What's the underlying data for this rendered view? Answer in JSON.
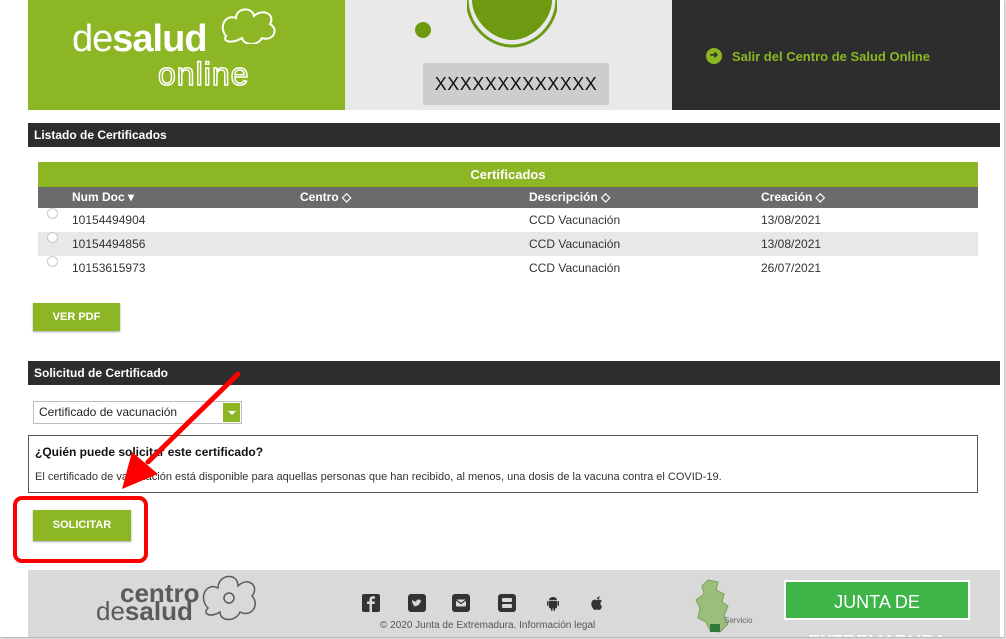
{
  "header": {
    "logo_line1_light": "de",
    "logo_line1_bold": "salud",
    "logo_line2": "online",
    "user_name": "XXXXXXXXXXXXX",
    "exit_label": "Salir del Centro de Salud Online"
  },
  "listado": {
    "section_title": "Listado de Certificados",
    "table_caption": "Certificados",
    "columns": [
      "Num Doc ▾",
      "Centro ◇",
      "Descripción ◇",
      "Creación ◇"
    ],
    "rows": [
      {
        "num_doc": "10154494904",
        "centro": "",
        "descripcion": "CCD Vacunación",
        "creacion": "13/08/2021"
      },
      {
        "num_doc": "10154494856",
        "centro": "",
        "descripcion": "CCD Vacunación",
        "creacion": "13/08/2021"
      },
      {
        "num_doc": "10153615973",
        "centro": "",
        "descripcion": "CCD Vacunación",
        "creacion": "26/07/2021"
      }
    ],
    "ver_pdf_label": "VER PDF"
  },
  "solicitud": {
    "section_title": "Solicitud de Certificado",
    "select_value": "Certificado de vacunación",
    "info_question": "¿Quién puede solicitar este certificado?",
    "info_description": "El certificado de vacunación está disponible para aquellas personas que han recibido, al menos, una dosis de la vacuna contra el COVID-19.",
    "solicitar_label": "SOLICITAR"
  },
  "footer": {
    "logo_line1": "centro",
    "logo_line2_light": "de",
    "logo_line2_bold": "salud",
    "social_icons": [
      "facebook-icon",
      "twitter-icon",
      "mail-icon",
      "youtube-icon",
      "android-icon",
      "apple-icon"
    ],
    "copyright": "© 2020 Junta de Extremadura. Información legal",
    "servicio_label": "Servicio",
    "junta_label": "JUNTA DE EXTREMADURA"
  },
  "colors": {
    "brand_green": "#8cb623",
    "dark_bar": "#2d2d2d",
    "annotation_red": "#ff0000",
    "junta_green": "#3fb449"
  }
}
